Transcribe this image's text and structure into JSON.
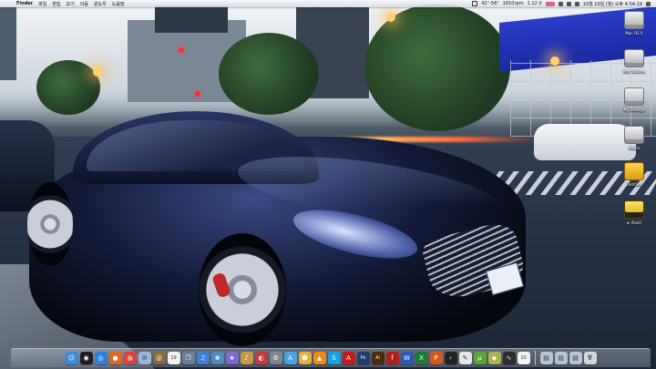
{
  "menubar": {
    "apple_glyph": "",
    "app_name": "Finder",
    "menus": [
      "파일",
      "편집",
      "보기",
      "이동",
      "윈도우",
      "도움말"
    ],
    "weather": "42°-56°",
    "cpu": "1810rpm",
    "disk": "1.12 V",
    "clock": "10월 10일 (월) 오후 4:54:19"
  },
  "desktop_icons": [
    {
      "label": "Mac OS X",
      "kind": "hd"
    },
    {
      "label": "Mac Volume",
      "kind": "hd"
    },
    {
      "label": "My Storage",
      "kind": "hd"
    },
    {
      "label": "Media",
      "kind": "hd"
    },
    {
      "label": "Untitled",
      "kind": "usb"
    },
    {
      "label": "★ (Root)",
      "kind": "usb2"
    }
  ],
  "dock": {
    "items": [
      {
        "name": "finder",
        "color": "#3a8de0",
        "glyph": "☺"
      },
      {
        "name": "dashboard",
        "color": "#1d1d1d",
        "glyph": "◉"
      },
      {
        "name": "safari",
        "color": "#2f7fd8",
        "glyph": "◎"
      },
      {
        "name": "firefox",
        "color": "#e3661f",
        "glyph": "●"
      },
      {
        "name": "chrome",
        "color": "#d9443a",
        "glyph": "◍"
      },
      {
        "name": "mail",
        "color": "#9bb6d8",
        "glyph": "✉"
      },
      {
        "name": "address-book",
        "color": "#8a6a3b",
        "glyph": "@"
      },
      {
        "name": "ical",
        "color": "#f1f1f1",
        "glyph": "19"
      },
      {
        "name": "preview",
        "color": "#6c7f9a",
        "glyph": "❐"
      },
      {
        "name": "itunes",
        "color": "#3c7fd6",
        "glyph": "♫"
      },
      {
        "name": "iphoto",
        "color": "#4f8dbf",
        "glyph": "❀"
      },
      {
        "name": "imovie",
        "color": "#7b6ad0",
        "glyph": "★"
      },
      {
        "name": "garageband",
        "color": "#c79a48",
        "glyph": "♪"
      },
      {
        "name": "photo-booth",
        "color": "#c53a3a",
        "glyph": "◐"
      },
      {
        "name": "system-preferences",
        "color": "#7d8793",
        "glyph": "⚙"
      },
      {
        "name": "app-store",
        "color": "#4aa3df",
        "glyph": "A"
      },
      {
        "name": "adium",
        "color": "#e3b13d",
        "glyph": "☻"
      },
      {
        "name": "vlc",
        "color": "#f08a14",
        "glyph": "▲"
      },
      {
        "name": "skype",
        "color": "#1aa1e0",
        "glyph": "S"
      },
      {
        "name": "acrobat",
        "color": "#c21c1c",
        "glyph": "A"
      },
      {
        "name": "photoshop",
        "color": "#1e3d6b",
        "glyph": "Ps"
      },
      {
        "name": "illustrator",
        "color": "#4a2a10",
        "glyph": "Ai"
      },
      {
        "name": "flash",
        "color": "#b0201a",
        "glyph": "f"
      },
      {
        "name": "word",
        "color": "#2a5bb6",
        "glyph": "W"
      },
      {
        "name": "excel",
        "color": "#1f7a3a",
        "glyph": "X"
      },
      {
        "name": "powerpoint",
        "color": "#d2591f",
        "glyph": "P"
      },
      {
        "name": "terminal",
        "color": "#222222",
        "glyph": "›"
      },
      {
        "name": "textedit",
        "color": "#e6e6e6",
        "glyph": "✎"
      },
      {
        "name": "utorrent",
        "color": "#5aa53a",
        "glyph": "µ"
      },
      {
        "name": "cyberduck",
        "color": "#a9b54a",
        "glyph": "◆"
      },
      {
        "name": "activity-monitor",
        "color": "#2c2c2c",
        "glyph": "∿"
      },
      {
        "name": "calendar-widget",
        "color": "#f3f3f3",
        "glyph": "10"
      }
    ],
    "right_items": [
      {
        "name": "applications-stack",
        "color": "#b9c4d3",
        "glyph": "▤"
      },
      {
        "name": "documents-stack",
        "color": "#b9c4d3",
        "glyph": "▤"
      },
      {
        "name": "downloads-stack",
        "color": "#b9c4d3",
        "glyph": "▤"
      },
      {
        "name": "trash",
        "color": "#d4d8de",
        "glyph": "🗑"
      }
    ]
  }
}
